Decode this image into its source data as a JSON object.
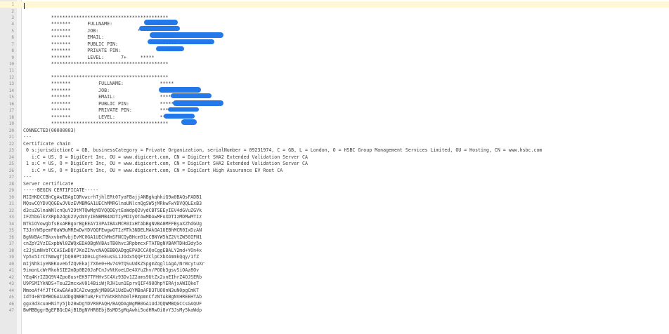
{
  "lines": [
    {
      "n": "1",
      "t": ""
    },
    {
      "n": "2",
      "t": ""
    },
    {
      "n": "3",
      "t": "          ******************************************"
    },
    {
      "n": "4",
      "t": "          *******      FULLNAME:            *****"
    },
    {
      "n": "5",
      "t": "          *******      JOB:              *****"
    },
    {
      "n": "6",
      "t": "          *******      EMAIL:                     ****"
    },
    {
      "n": "7",
      "t": "          *******      PUBLIC PIN:                *****"
    },
    {
      "n": "8",
      "t": "          *******      PRIVATE PIN:                *****"
    },
    {
      "n": "9",
      "t": "          *******      LEVEL:      7+     *****"
    },
    {
      "n": "10",
      "t": "          ******************************************"
    },
    {
      "n": "11",
      "t": ""
    },
    {
      "n": "12",
      "t": "          ******************************************"
    },
    {
      "n": "13",
      "t": "          *******          FULLNAME:             *****"
    },
    {
      "n": "14",
      "t": "          *******          JOB:                  *****"
    },
    {
      "n": "15",
      "t": "          *******          EMAIL:                *****"
    },
    {
      "n": "16",
      "t": "          *******          PUBLIC PIN:           *****"
    },
    {
      "n": "17",
      "t": "          *******          PRIVATE PIN:          *****"
    },
    {
      "n": "18",
      "t": "          *******          LEVEL:                *****"
    },
    {
      "n": "19",
      "t": "          ******************************************"
    },
    {
      "n": "20",
      "t": "CONNECTED(00000003)"
    },
    {
      "n": "21",
      "t": "---"
    },
    {
      "n": "22",
      "t": "Certificate chain"
    },
    {
      "n": "23",
      "t": " 0 s:jurisdictionC = GB, businessCategory = Private Organization, serialNumber = 09231974, C = GB, L = London, O = HSBC Group Management Services Limited, OU = Hosting, CN = www.hsbc.com"
    },
    {
      "n": "24",
      "t": "   i:C = US, O = DigiCert Inc, OU = www.digicert.com, CN = DigiCert SHA2 Extended Validation Server CA"
    },
    {
      "n": "25",
      "t": " 1 s:C = US, O = DigiCert Inc, OU = www.digicert.com, CN = DigiCert SHA2 Extended Validation Server CA"
    },
    {
      "n": "26",
      "t": "   i:C = US, O = DigiCert Inc, OU = www.digicert.com, CN = DigiCert High Assurance EV Root CA"
    },
    {
      "n": "27",
      "t": "---"
    },
    {
      "n": "28",
      "t": "Server certificate"
    },
    {
      "n": "29",
      "t": "-----BEGIN CERTIFICATE-----"
    },
    {
      "n": "30",
      "t": "MIIHKDCCBhCgAwIBAgIQRvwcrhTjhlERt07yaFBajjANBgkqhkiG9w0BAQsFADB1"
    },
    {
      "n": "31",
      "t": "MQswCQYDVQQGEwJVUzEVMBMGA1UEChMMRGlnaUNlcnQgSW5jMRkwFwYDVQQLExB3"
    },
    {
      "n": "32",
      "t": "d3cuZGlnaWNlcnQuY29tMTQwMgYDVQQDEytEaWdpQ2VydCBTSEEyIEV4dGVuZGVk"
    },
    {
      "n": "33",
      "t": "IFZhbGlkYXRpb24gU2VydmVyIENBMB4XDTIyMDIyOTAwMDAwMFoXDTIzMDMwMTIz"
    },
    {
      "n": "34",
      "t": "NTkiOVowgbfsExARBgorBgEEAYI3PAIBAxMCR0IxHTAbBgNVBA8MFFByaXZhdGUg"
    },
    {
      "n": "35",
      "t": "T3JnYW5pemF0aW9uMREwDwYDVQQFEwgwOTIzMTk3NDELMAkGA1UEBhMCR0IxDzAN"
    },
    {
      "n": "36",
      "t": "BgNVBAcTBkxvbmRvbjEvMC0GA1UEChMmSFNCQyBHcm91cCBNYW5hZ2VtZW50IFN1"
    },
    {
      "n": "37",
      "t": "cnZpY2VzIExpbWl0ZWQxEDAOBgNVBAsTB0hvc3RpbmcxFTATBgNVBAMTDHd3dy5o"
    },
    {
      "n": "38",
      "t": "c2JjLmNvbTCCASIwDQYJKoZIhvcNAQEBBQADggEPADCCAQoCggEBALY2md+YOn4x"
    },
    {
      "n": "39",
      "t": "Vp5x5IrCTNmwgTjbQ08Pt1D0sLgYeEusSL1JOdx5QQFtZClpCXbX4mmkQqy/1fZ"
    },
    {
      "n": "40",
      "t": "mIjNhkiyeNEKoveGfZQvEkaj7X6e0+Hv749TQSuUdKZSpgmZqgl1AgA/NrWcytuXr"
    },
    {
      "n": "41",
      "t": "9imonLcWrRkohSIE2mDp0B20JaFCnJvNtKoeLDe4XYuZhv/POOb3gsvSiOAz8Ov"
    },
    {
      "n": "42",
      "t": "YEq4KrIZDQ9V4Zpo8us+EK97TFHHvSC4Xz93Dv1Z2ams9UtZx2xnEIhrZ4OJSERb"
    },
    {
      "n": "43",
      "t": "U9PSMIYkNDS+TeuZ2mcxwV014BiiWjRJH1un1EprvQIF490OhpYERAjxAWIQkeT"
    },
    {
      "n": "44",
      "t": "MmooAf4fJTfCAwEAAaOCA2cwggNjMB8GA1UdIwQYMBaAFD3TUOOnN3uN0pgCmKT"
    },
    {
      "n": "45",
      "t": "IdT4+BYDMBOGA1UdDgQWBBTuB/FxTVGtKRhhb0lFRmpmnCfzNTAkBgNVHREEHTAb"
    },
    {
      "n": "46",
      "t": "ggx3d3cuaHNiYy5jb20wDgYDVR0PAQH/BAQDAgWgMB0GA1UdJQQWMBQGCCsGAQUF"
    },
    {
      "n": "47",
      "t": "BwMBBggrBgEFBQcDAjB1BgNVHR8EbjBsMDSgMqAwhi5odHRwOi8vY3JsMy5kaWdp"
    }
  ]
}
